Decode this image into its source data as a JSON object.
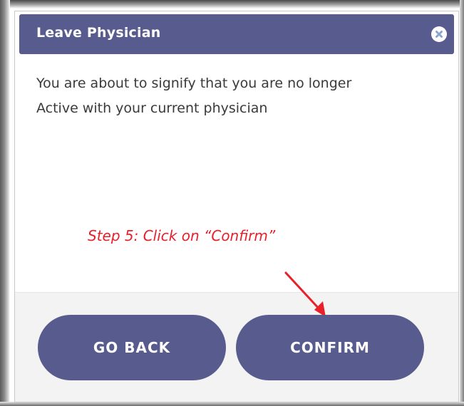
{
  "dialog": {
    "title": "Leave Physician",
    "close_icon": "close-icon",
    "message_line1": "You are about to signify that you are no longer",
    "message_line2": "Active with your current physician"
  },
  "annotation": {
    "text": "Step 5: Click on “Confirm”",
    "color": "#e8202a"
  },
  "footer": {
    "go_back_label": "GO BACK",
    "confirm_label": "CONFIRM"
  },
  "colors": {
    "accent": "#585b8d",
    "footer_bg": "#f3f3f3"
  }
}
